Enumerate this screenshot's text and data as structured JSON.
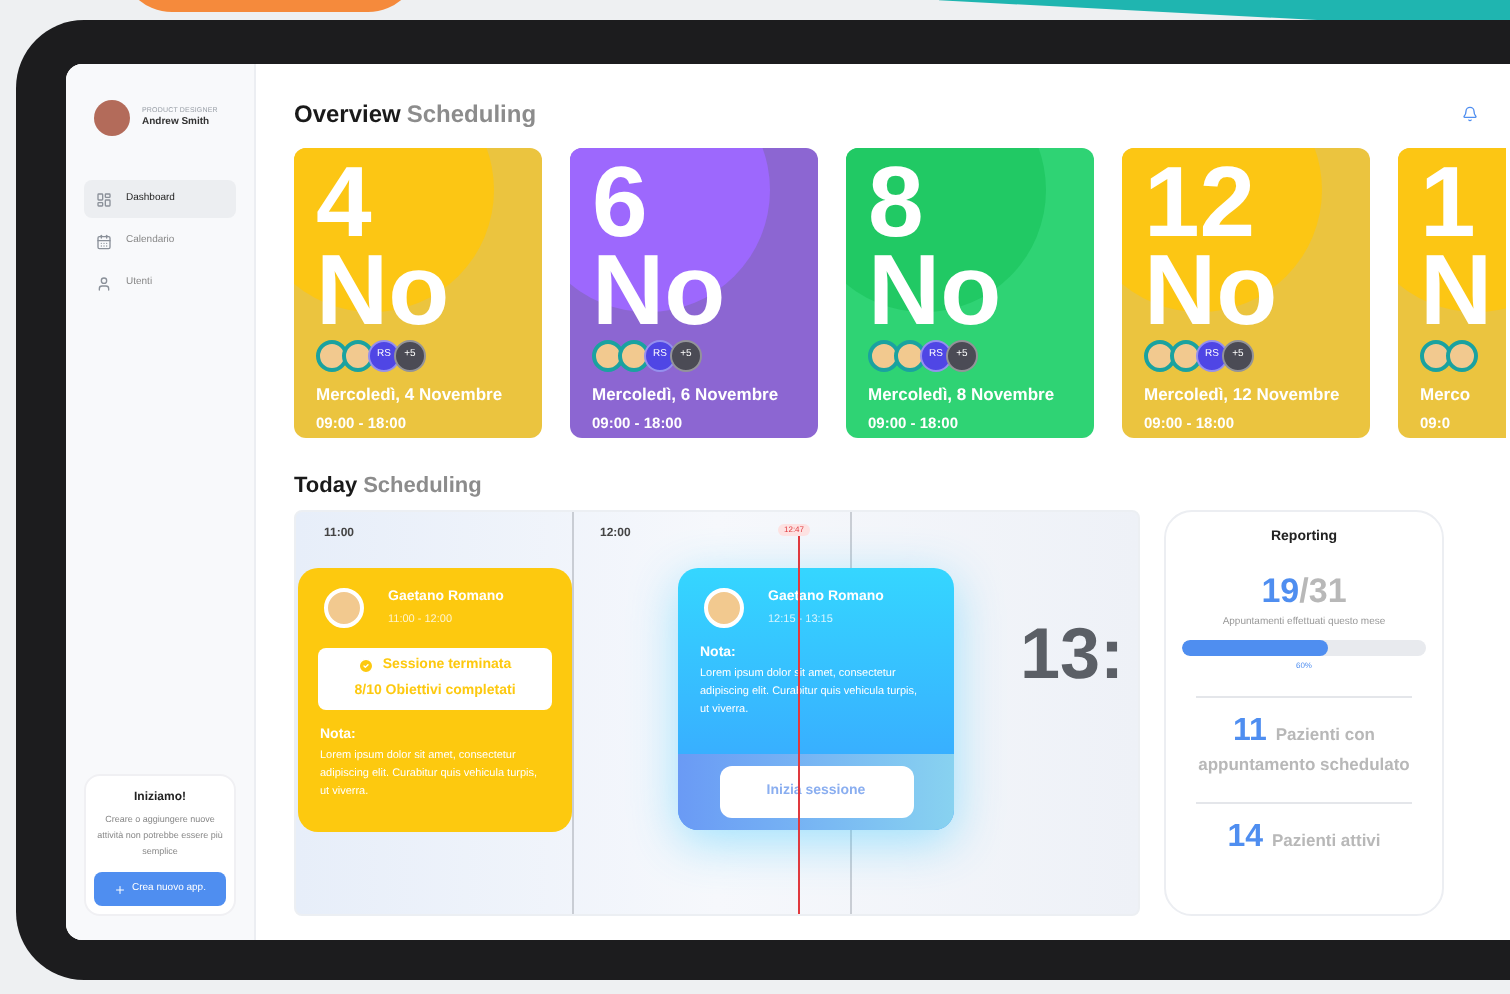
{
  "profile": {
    "role": "PRODUCT DESIGNER",
    "name": "Andrew Smith"
  },
  "nav": [
    {
      "label": "Dashboard",
      "selected": true
    },
    {
      "label": "Calendario",
      "selected": false
    },
    {
      "label": "Utenti",
      "selected": false
    }
  ],
  "promo": {
    "title": "Iniziamo!",
    "text": "Creare o aggiungere nuove attività non potrebbe essere più semplice",
    "button": "Crea nuovo app."
  },
  "overview": {
    "title": "Overview",
    "subtitle": "Scheduling"
  },
  "cards": [
    {
      "day": "4",
      "month": "No",
      "color": "#ebc43f",
      "avatars": [
        "RS",
        "+5"
      ],
      "date": "Mercoledì, 4 Novembre",
      "time": "09:00 - 18:00"
    },
    {
      "day": "6",
      "month": "No",
      "color": "#8c66d2",
      "avatars": [
        "RS",
        "+5"
      ],
      "date": "Mercoledì, 6 Novembre",
      "time": "09:00 - 18:00"
    },
    {
      "day": "8",
      "month": "No",
      "color": "#2fd374",
      "avatars": [
        "RS",
        "+5"
      ],
      "date": "Mercoledì, 8 Novembre",
      "time": "09:00 - 18:00"
    },
    {
      "day": "12",
      "month": "No",
      "color": "#ebc43f",
      "avatars": [
        "RS",
        "+5"
      ],
      "date": "Mercoledì, 12 Novembre",
      "time": "09:00 - 18:00"
    },
    {
      "day": "1",
      "month": "N",
      "color": "#ebc43f",
      "date": "Merco",
      "time": "09:0"
    }
  ],
  "today": {
    "title": "Today",
    "subtitle": "Scheduling"
  },
  "timeline": {
    "hours": [
      "11:00",
      "12:00"
    ],
    "now": "12:47",
    "next_hour": "13:"
  },
  "sessions": [
    {
      "kind": "done",
      "name": "Gaetano Romano",
      "time": "11:00 - 12:00",
      "completed": true,
      "status": "Sessione terminata",
      "progress": "8/10 Obiettivi completati",
      "note_label": "Nota:",
      "note": "Lorem ipsum dolor sit amet, consectetur adipiscing elit. Curabitur quis vehicula turpis, ut viverra."
    },
    {
      "kind": "upcoming",
      "name": "Gaetano Romano",
      "time": "12:15 - 13:15",
      "note_label": "Nota:",
      "note": "Lorem ipsum dolor sit amet, consectetur adipiscing elit. Curabitur quis vehicula turpis, ut viverra.",
      "button": "Inizia sessione"
    }
  ],
  "report": {
    "title": "Reporting",
    "done": "19",
    "total": "/31",
    "caption": "Appuntamenti effettuati questo mese",
    "level": 0.6,
    "percent": "60%",
    "stats": [
      {
        "value": "11",
        "label": "Pazienti con appuntamento schedulato"
      },
      {
        "value": "14",
        "label": "Pazienti attivi"
      }
    ]
  }
}
